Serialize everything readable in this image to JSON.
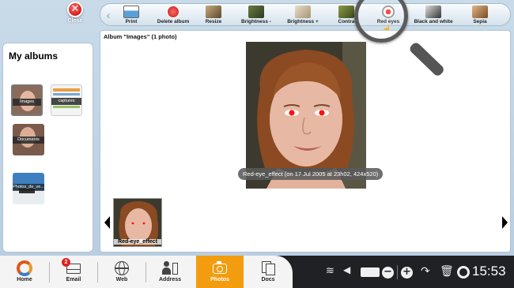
{
  "close": {
    "icon": "x-icon",
    "label": "Close"
  },
  "toolbar": {
    "back_icon": "chevron-left-icon",
    "tools": [
      {
        "id": "print",
        "label": "Print",
        "icon": "printer-icon",
        "color": "#5aa0d8"
      },
      {
        "id": "delete-album",
        "label": "Delete album",
        "icon": "delete-icon",
        "color": "#d03030"
      },
      {
        "id": "resize",
        "label": "Resize",
        "icon": "resize-icon",
        "color": "#7a6a48"
      },
      {
        "id": "brightness-minus",
        "label": "Brightness -",
        "icon": "brightness-down-icon",
        "color": "#5a6a3a"
      },
      {
        "id": "brightness-plus",
        "label": "Brightness +",
        "icon": "brightness-up-icon",
        "color": "#b7a68a"
      },
      {
        "id": "contrast",
        "label": "Contra",
        "icon": "contrast-icon",
        "color": "#6a7a3a"
      },
      {
        "id": "red-eyes",
        "label": "Red eyes",
        "icon": "red-eye-icon",
        "color": "#c02020"
      },
      {
        "id": "black-and-white",
        "label": "Black and white",
        "icon": "black-white-icon",
        "color": "#666666"
      },
      {
        "id": "sepia",
        "label": "Sepia",
        "icon": "sepia-icon",
        "color": "#a06a30"
      }
    ]
  },
  "sidebar": {
    "title": "My albums",
    "albums": [
      {
        "label": "Images",
        "selected": true
      },
      {
        "label": "captures",
        "selected": false
      },
      {
        "label": "Documents",
        "selected": false
      },
      {
        "label": "Photos_de_ve...",
        "selected": false
      }
    ]
  },
  "main": {
    "album_title": "Album \"Images\" (1 photo)",
    "caption": "Red-eye_effect (on 17 Jul 2005 at 23h02, 424x520)",
    "thumb_label": "Red-eye_effect"
  },
  "taskbar": {
    "apps": [
      {
        "label": "Home",
        "icon": "home-icon",
        "active": false
      },
      {
        "label": "Email",
        "icon": "email-icon",
        "active": false,
        "badge": "2"
      },
      {
        "label": "Web",
        "icon": "globe-icon",
        "active": false
      },
      {
        "label": "Address",
        "icon": "address-book-icon",
        "active": false
      },
      {
        "label": "Photos",
        "icon": "camera-icon",
        "active": true
      },
      {
        "label": "Docs",
        "icon": "docs-icon",
        "active": false
      }
    ],
    "clock": "15:53"
  },
  "colors": {
    "accent": "#f39c0f",
    "taskbar": "#1f2125",
    "close": "#d01010"
  }
}
